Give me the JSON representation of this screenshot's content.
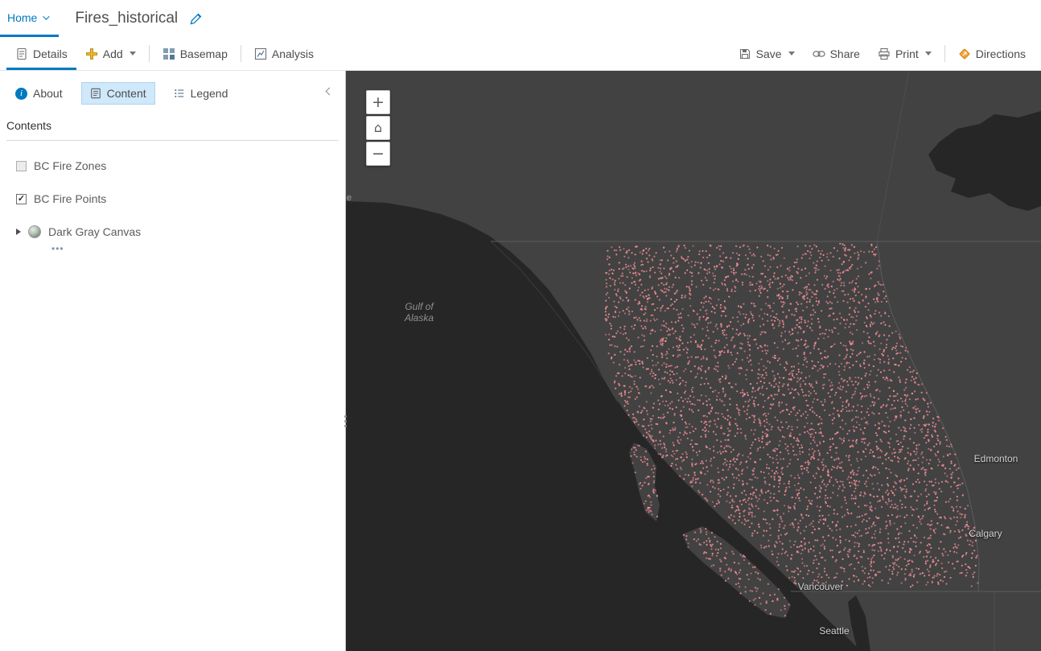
{
  "header": {
    "home_label": "Home",
    "title": "Fires_historical"
  },
  "toolbar": {
    "details_label": "Details",
    "add_label": "Add",
    "basemap_label": "Basemap",
    "analysis_label": "Analysis",
    "save_label": "Save",
    "share_label": "Share",
    "print_label": "Print",
    "directions_label": "Directions"
  },
  "sidebar": {
    "tabs": {
      "about": "About",
      "content": "Content",
      "legend": "Legend"
    },
    "contents_heading": "Contents",
    "layers": [
      {
        "label": "BC Fire Zones",
        "checked": false
      },
      {
        "label": "BC Fire Points",
        "checked": true
      },
      {
        "label": "Dark Gray Canvas"
      }
    ],
    "layer_options_ellipsis": "•••"
  },
  "map": {
    "controls": {
      "zoom_in": "+",
      "home": "⌂",
      "zoom_out": "−"
    },
    "labels": {
      "gulf_of_alaska": "Gulf of\nAlaska",
      "edge_partial": "e",
      "cities": [
        "Edmonton",
        "Calgary",
        "Vancouver",
        "Seattle"
      ]
    },
    "colors": {
      "ocean": "#262626",
      "land": "#424242",
      "boundary": "#5c5c5c",
      "fire_point": "#f08d95",
      "accent_blue": "#0079c1"
    },
    "fire_points": {
      "count": 4200,
      "seed": 7,
      "dot_radius": 1.1
    }
  }
}
